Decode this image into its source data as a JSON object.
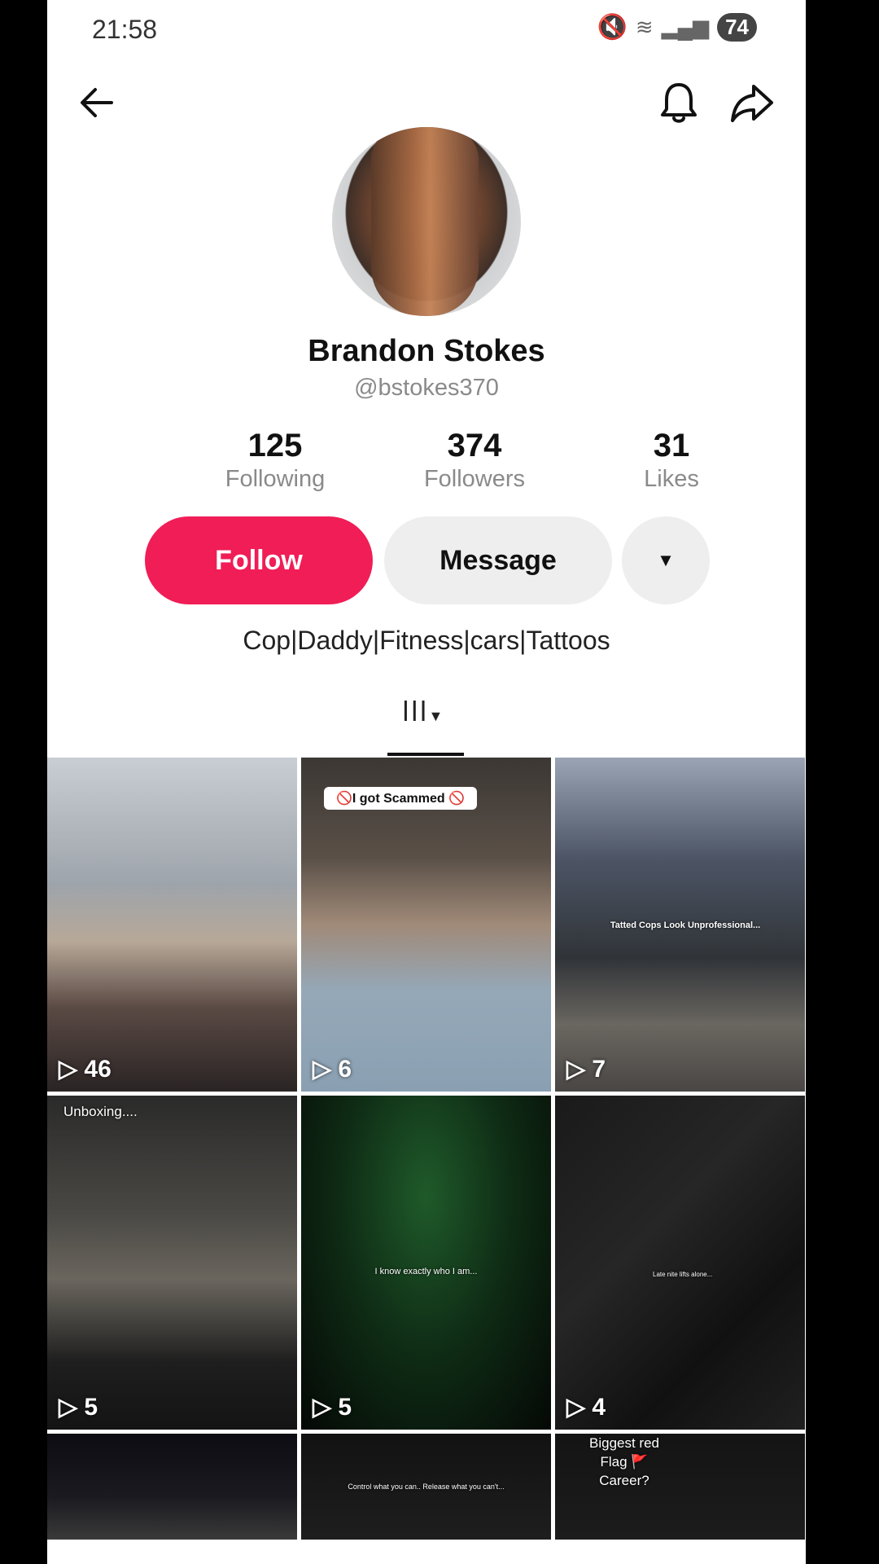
{
  "status_bar": {
    "time": "21:58",
    "battery": "74"
  },
  "profile": {
    "name": "Brandon Stokes",
    "handle": "@bstokes370",
    "bio": "Cop|Daddy|Fitness|cars|Tattoos",
    "stats": [
      {
        "value": "125",
        "label": "Following"
      },
      {
        "value": "374",
        "label": "Followers"
      },
      {
        "value": "31",
        "label": "Likes"
      }
    ]
  },
  "actions": {
    "follow": "Follow",
    "message": "Message"
  },
  "icons": [
    "back-arrow-icon",
    "bell-icon",
    "share-icon",
    "dropdown-arrow-icon",
    "grid-tab-icon",
    "play-icon"
  ],
  "videos": [
    {
      "views": "46",
      "caption": ""
    },
    {
      "views": "6",
      "caption": "🚫I got Scammed 🚫"
    },
    {
      "views": "7",
      "caption": "Tatted Cops Look Unprofessional..."
    },
    {
      "views": "5",
      "caption": "Unboxing...."
    },
    {
      "views": "5",
      "caption": "I know exactly who I am..."
    },
    {
      "views": "4",
      "caption": "Late nite lifts alone..."
    },
    {
      "views": "",
      "caption": ""
    },
    {
      "views": "",
      "caption": "Control what you can.. Release what you can't..."
    },
    {
      "views": "",
      "caption": "Biggest red Flag 🚩 Career?"
    }
  ],
  "colors": {
    "follow_button": "#f01d56",
    "secondary_button": "#eeeeef"
  }
}
